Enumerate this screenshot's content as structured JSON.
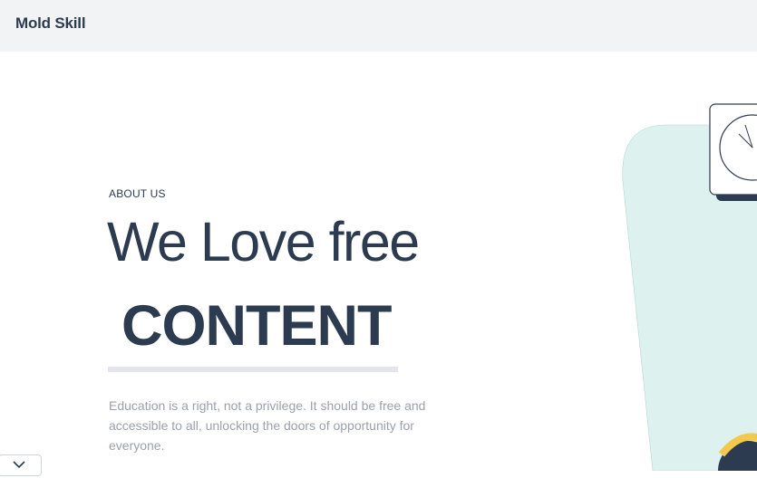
{
  "header": {
    "brand": "Mold Skill"
  },
  "hero": {
    "eyebrow": "ABOUT US",
    "headline": "We Love free",
    "highlight": "CONTENT",
    "description": "Education is a right, not a privilege. It should be free and accessible to all, unlocking the doors of opportunity for everyone."
  },
  "colors": {
    "text": "#2d3b50",
    "muted": "#9aa1ad",
    "header_bg": "#f2f3f5",
    "art_bg": "#ddf1ef",
    "accent_yellow": "#f2c94c"
  },
  "icons": {
    "scroll_toggle": "chevron-down-icon"
  }
}
